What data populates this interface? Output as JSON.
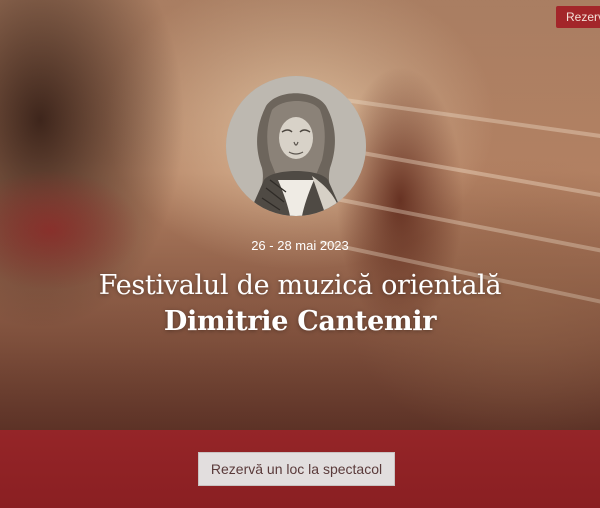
{
  "header": {
    "reserve_label": "Rezervă"
  },
  "hero": {
    "date": "26 - 28 mai 2023",
    "title_line1": "Festivalul de muzică orientală",
    "title_line2": "Dimitrie Cantemir"
  },
  "cta": {
    "label": "Rezervă un loc la spectacol"
  },
  "colors": {
    "accent": "#8a1f22",
    "button_bg": "#e2dede",
    "text_light": "#ffffff"
  },
  "icons": {
    "portrait": "portrait-image"
  }
}
